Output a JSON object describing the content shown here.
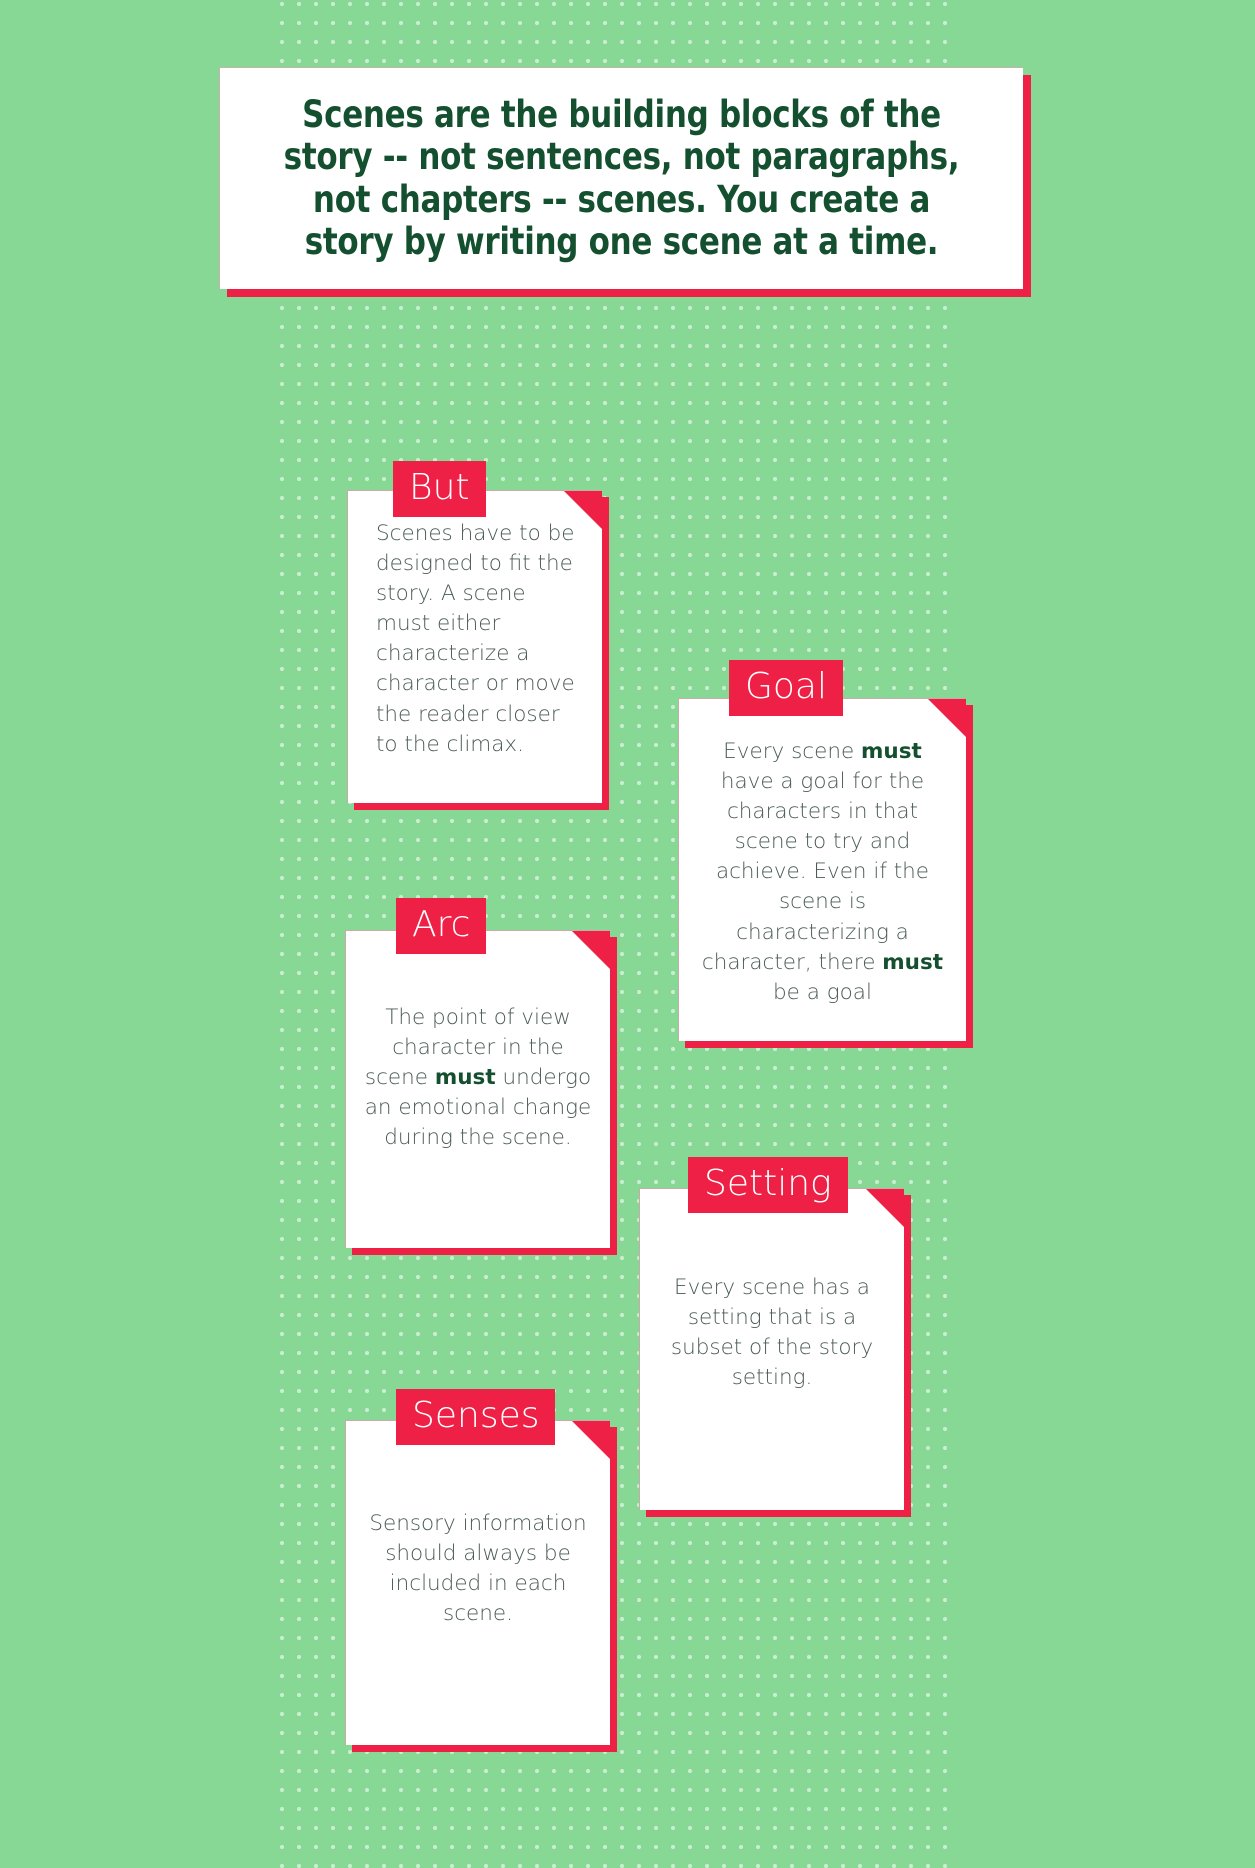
{
  "background": {
    "green": "#86d894",
    "accent_red": "#ef2046",
    "dark_green_text": "#14502f",
    "body_text_gray": "#4b5b56"
  },
  "header": {
    "quote": "Scenes are the building blocks of the story  -- not sentences, not paragraphs, not chapters -- scenes. You create a story by writing one scene at a time."
  },
  "cards": [
    {
      "title": "But",
      "body_html": "Scenes have to be designed to fit the story.  A scene must either characterize a character or move the reader closer to the climax.",
      "align": "left"
    },
    {
      "title": "Goal",
      "body_html": "Every scene <b>must</b> have a goal for the characters in that scene to try and achieve. Even if the scene is characterizing a character, there <b>must</b> be a goal",
      "align": "center"
    },
    {
      "title": "Arc",
      "body_html": "The point of view character in the scene <b>must</b> undergo an emotional change during the scene.",
      "align": "center"
    },
    {
      "title": "Setting",
      "body_html": "Every scene has a setting that is a subset of the story setting.",
      "align": "center"
    },
    {
      "title": "Senses",
      "body_html": "Sensory information should always be included in each scene.",
      "align": "center"
    }
  ]
}
